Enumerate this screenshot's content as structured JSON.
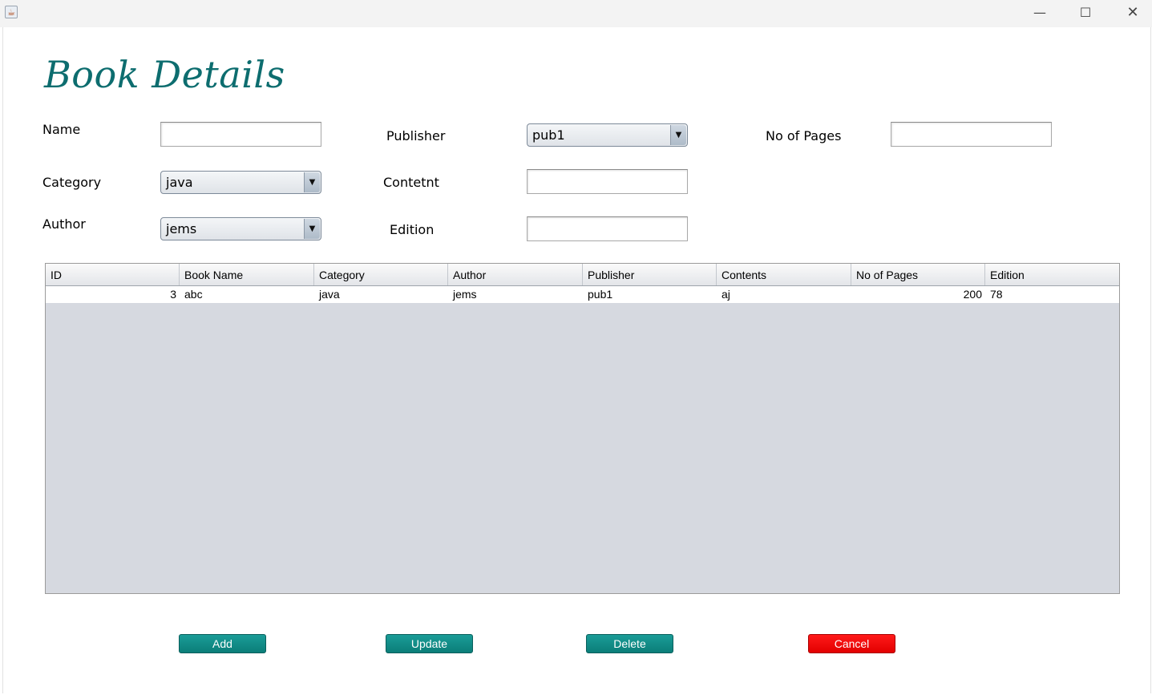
{
  "window": {
    "app_icon": "java-cup-icon",
    "controls": {
      "minimize": "—",
      "maximize": "☐",
      "close": "✕"
    }
  },
  "page": {
    "title": "Book Details"
  },
  "form": {
    "name": {
      "label": "Name",
      "value": ""
    },
    "category": {
      "label": "Category",
      "selected": "java"
    },
    "author": {
      "label": "Author",
      "selected": "jems"
    },
    "publisher": {
      "label": "Publisher",
      "selected": "pub1"
    },
    "content": {
      "label": "Contetnt",
      "value": ""
    },
    "edition": {
      "label": "Edition",
      "value": ""
    },
    "pages": {
      "label": "No of Pages",
      "value": ""
    }
  },
  "table": {
    "columns": [
      "ID",
      "Book Name",
      "Category",
      "Author",
      "Publisher",
      "Contents",
      "No of Pages",
      "Edition"
    ],
    "rows": [
      [
        "3",
        "abc",
        "java",
        "jems",
        "pub1",
        "aj",
        "200",
        "78"
      ]
    ]
  },
  "buttons": {
    "add": "Add",
    "update": "Update",
    "delete": "Delete",
    "cancel": "Cancel"
  },
  "colors": {
    "title": "#0d6d6f",
    "button_teal": "#0f8a85",
    "button_cancel": "#f01010",
    "table_background": "#d6d9e0"
  }
}
